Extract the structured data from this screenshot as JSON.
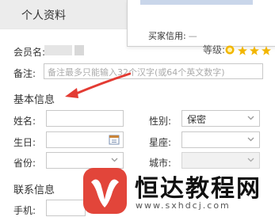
{
  "tab": {
    "title": "个人资料"
  },
  "popup": {
    "buyer_label": "买家信用:",
    "buyer_value": "—"
  },
  "member": {
    "label": "会员名:",
    "level_label": "等级:"
  },
  "remark": {
    "label": "备注:",
    "placeholder": "备注最多只能输入32个汉字(或64个英文数字)"
  },
  "basic": {
    "title": "基本信息",
    "name_label": "姓名:",
    "gender_label": "性别:",
    "gender_value": "保密",
    "birthday_label": "生日:",
    "zodiac_label": "星座:",
    "province_label": "省份:",
    "city_label": "城市:"
  },
  "contact": {
    "title": "联系信息",
    "phone_label": "手机:"
  },
  "watermark": {
    "name": "恒达教程网",
    "url": "www.sxhdcj.com"
  },
  "colors": {
    "arrow": "#e33b33",
    "star": "#f2b600",
    "logo": "#e2453a"
  }
}
